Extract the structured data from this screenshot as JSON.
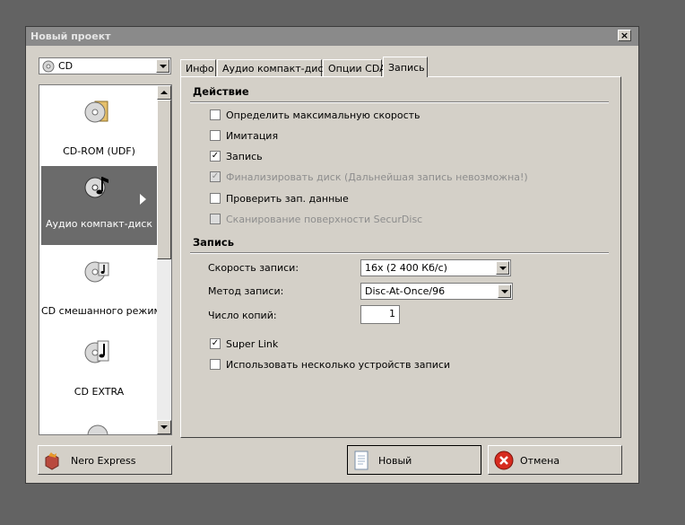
{
  "window": {
    "title": "Новый проект",
    "close_glyph": "×"
  },
  "disc_type": {
    "value": "CD"
  },
  "project_list": [
    {
      "label": "CD-ROM (UDF)",
      "icon": "cd-rom-udf-icon",
      "selected": false
    },
    {
      "label": "Аудио компакт-диск",
      "icon": "audio-cd-icon",
      "selected": true
    },
    {
      "label": "CD смешанного режима",
      "icon": "mixed-mode-cd-icon",
      "selected": false
    },
    {
      "label": "CD EXTRA",
      "icon": "cd-extra-icon",
      "selected": false
    }
  ],
  "tabs": [
    {
      "label": "Инфо",
      "active": false
    },
    {
      "label": "Аудио компакт-диск",
      "active": false
    },
    {
      "label": "Опции CDA",
      "active": false
    },
    {
      "label": "Запись",
      "active": true
    }
  ],
  "action_section": {
    "title": "Действие",
    "options": [
      {
        "label": "Определить максимальную скорость",
        "checked": false,
        "disabled": false
      },
      {
        "label": "Имитация",
        "checked": false,
        "disabled": false
      },
      {
        "label": "Запись",
        "checked": true,
        "disabled": false
      },
      {
        "label": "Финализировать диск (Дальнейшая запись невозможна!)",
        "checked": true,
        "disabled": true
      },
      {
        "label": "Проверить зап. данные",
        "checked": false,
        "disabled": false
      },
      {
        "label": "Сканирование поверхности SecurDisc",
        "checked": false,
        "disabled": true
      }
    ]
  },
  "write_section": {
    "title": "Запись",
    "speed_label": "Скорость записи:",
    "speed_value": "16x (2 400 Кб/с)",
    "method_label": "Метод записи:",
    "method_value": "Disc-At-Once/96",
    "copies_label": "Число копий:",
    "copies_value": "1",
    "super_link": {
      "label": "Super Link",
      "checked": true
    },
    "multi_device": {
      "label": "Использовать несколько устройств записи",
      "checked": false
    }
  },
  "buttons": {
    "nero_express": "Nero Express",
    "new": "Новый",
    "cancel": "Отмена"
  },
  "check_glyph": "✓"
}
